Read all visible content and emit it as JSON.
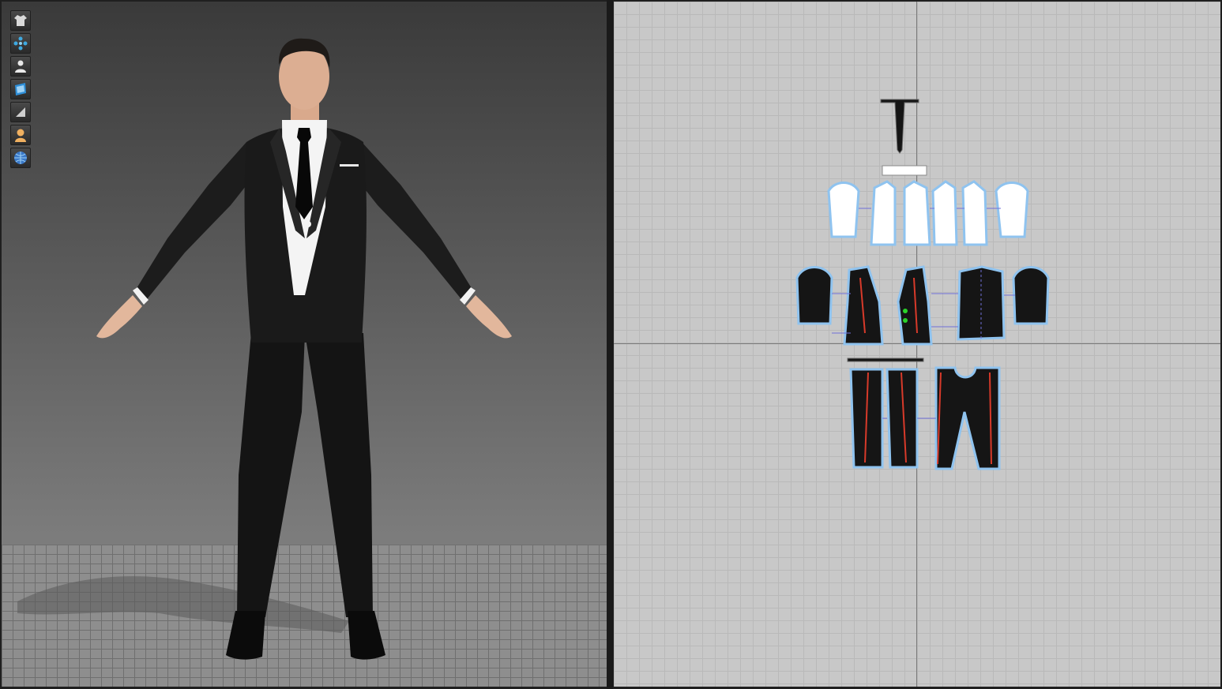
{
  "toolbar": {
    "tools": [
      {
        "name": "garment-icon",
        "color": "#d9d9d9"
      },
      {
        "name": "simulation-icon",
        "color": "#3fa9e0"
      },
      {
        "name": "avatar-icon",
        "color": "#e8e8e8"
      },
      {
        "name": "texture-icon",
        "color": "#2f8fd8"
      },
      {
        "name": "light-icon",
        "color": "#cfcfcf"
      },
      {
        "name": "skin-icon",
        "color": "#f0b060"
      },
      {
        "name": "globe-icon",
        "color": "#3a78c8"
      }
    ]
  },
  "colors": {
    "suit": "#161616",
    "shirt": "#f4f4f4",
    "pattern_outline": "#8fc3ef",
    "seam_line": "#d83a2a",
    "sewing_line": "#7070d8",
    "pin_point": "#2ad22a"
  }
}
